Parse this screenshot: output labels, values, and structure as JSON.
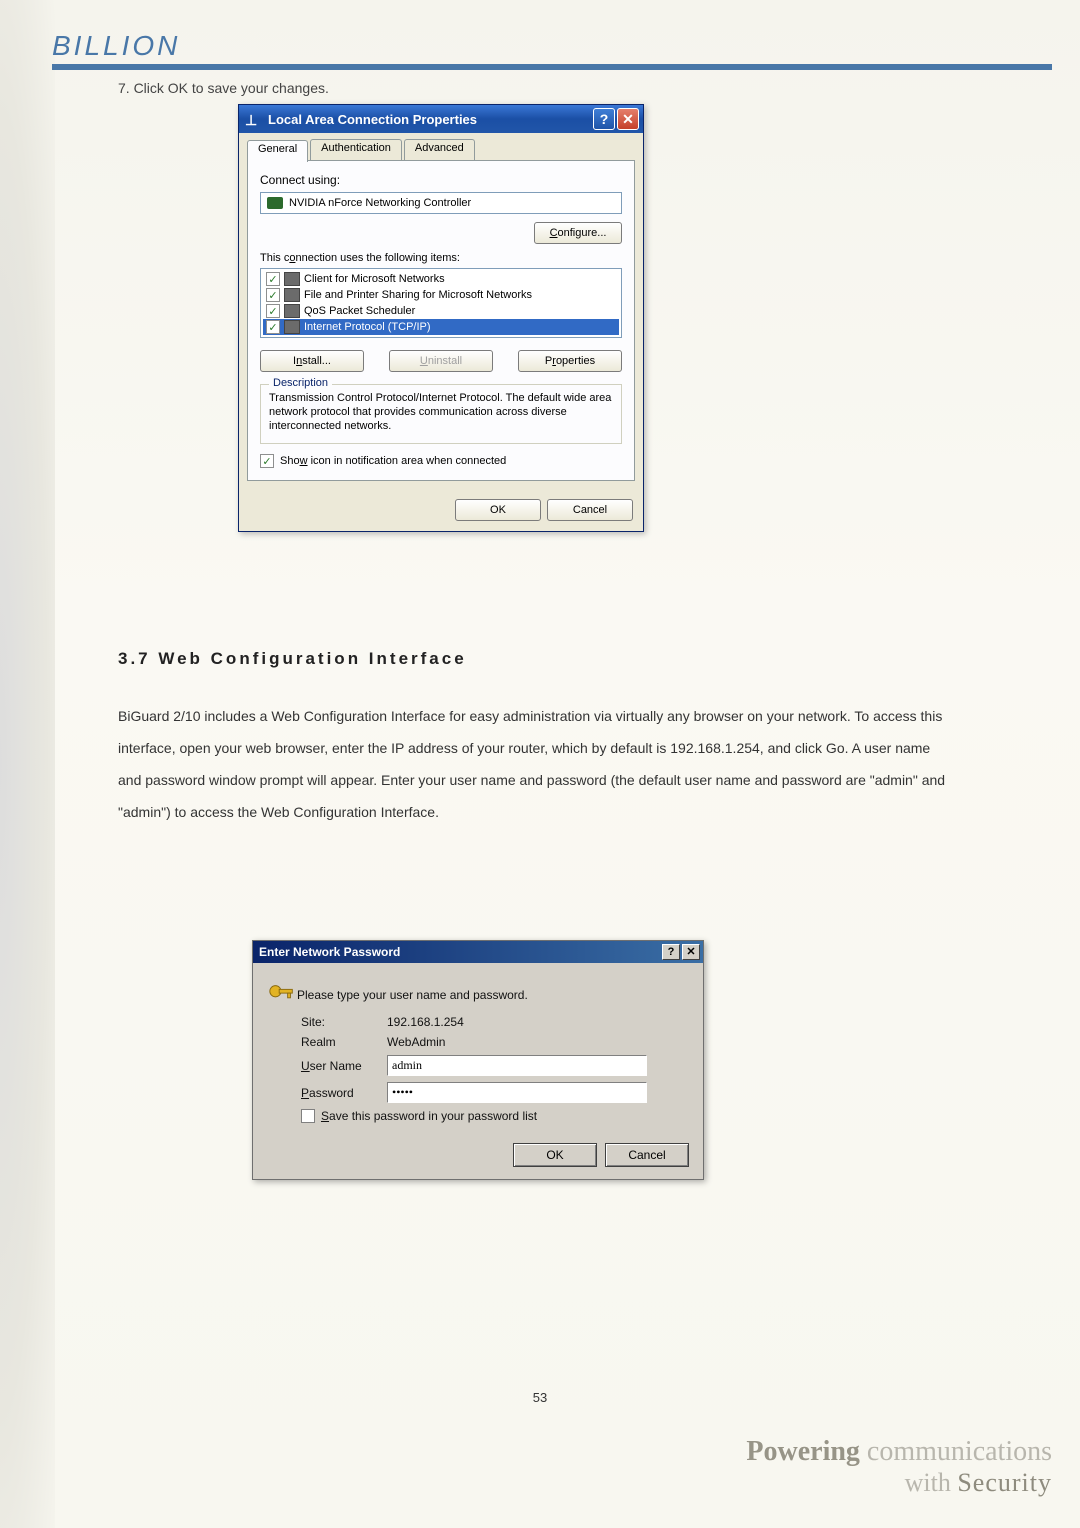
{
  "logo_text": "BILLION",
  "step7": "7. Click OK to save your changes.",
  "dialog1": {
    "title": "Local Area Connection Properties",
    "help": "?",
    "close": "✕",
    "tabs": {
      "general": "General",
      "auth": "Authentication",
      "adv": "Advanced"
    },
    "connect_using": "Connect using:",
    "adapter": "NVIDIA nForce Networking Controller",
    "configure": "Configure...",
    "items_label": "This connection uses the following items:",
    "items": [
      "Client for Microsoft Networks",
      "File and Printer Sharing for Microsoft Networks",
      "QoS Packet Scheduler",
      "Internet Protocol (TCP/IP)"
    ],
    "install": "Install...",
    "uninstall": "Uninstall",
    "properties": "Properties",
    "description_label": "Description",
    "description": "Transmission Control Protocol/Internet Protocol. The default wide area network protocol that provides communication across diverse interconnected networks.",
    "show_icon": "Show icon in notification area when connected",
    "ok": "OK",
    "cancel": "Cancel"
  },
  "section": {
    "heading": "3.7  Web Configuration Interface",
    "body": "BiGuard 2/10 includes a Web Configuration Interface for easy administration via virtually any browser on your network. To access this interface, open your web browser, enter the IP address of your router, which by default is 192.168.1.254, and click Go. A user name and password window prompt will appear. Enter your user name and password (the default user name and password are \"admin\" and \"admin\") to access the Web Configuration Interface."
  },
  "dialog2": {
    "title": "Enter Network Password",
    "help": "?",
    "close": "✕",
    "prompt": "Please type your user name and password.",
    "site_label": "Site:",
    "site": "192.168.1.254",
    "realm_label": "Realm",
    "realm": "WebAdmin",
    "user_label": "User Name",
    "user": "admin",
    "pass_label": "Password",
    "pass": "•••••",
    "save": "Save this password in your password list",
    "ok": "OK",
    "cancel": "Cancel"
  },
  "page_number": "53",
  "tagline": {
    "l1a": "Powering",
    "l1b": "communications",
    "l2a": "with",
    "l2b": "Security"
  }
}
